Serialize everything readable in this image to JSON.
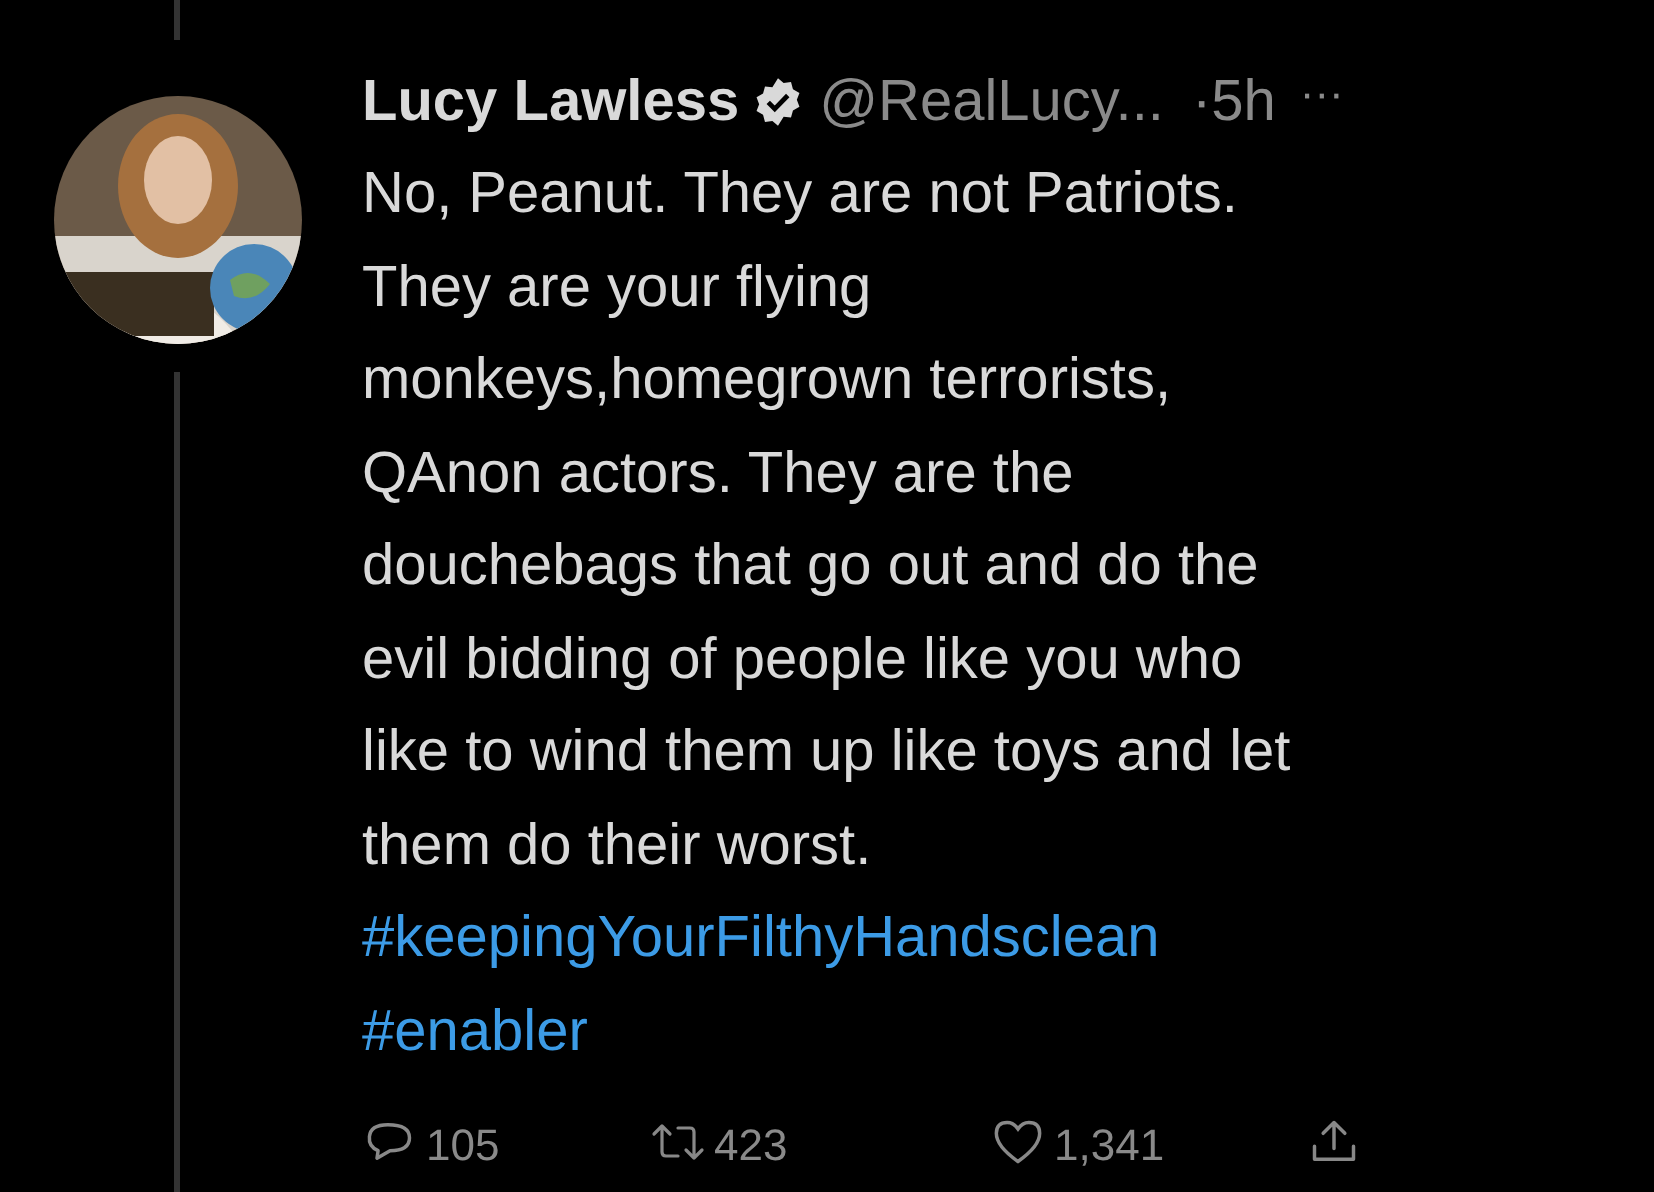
{
  "tweet": {
    "author_name": "Lucy Lawless",
    "verified": true,
    "handle": "@RealLucy...",
    "separator": "·",
    "time": "5h",
    "more": "···",
    "body_lines": [
      "No, Peanut. They are not Patriots.",
      "They are your flying",
      "monkeys,homegrown terrorists,",
      "QAnon actors. They are the",
      "douchebags that go out and do the",
      "evil bidding of people like you who",
      "like to wind them up like toys and let",
      "them do their worst."
    ],
    "hashtags": [
      "#keepingYourFilthyHandsclean",
      "#enabler"
    ],
    "actions": [
      {
        "kind": "reply",
        "count": "105"
      },
      {
        "kind": "retweet",
        "count": "423"
      },
      {
        "kind": "like",
        "count": "1,341"
      },
      {
        "kind": "share"
      }
    ]
  }
}
